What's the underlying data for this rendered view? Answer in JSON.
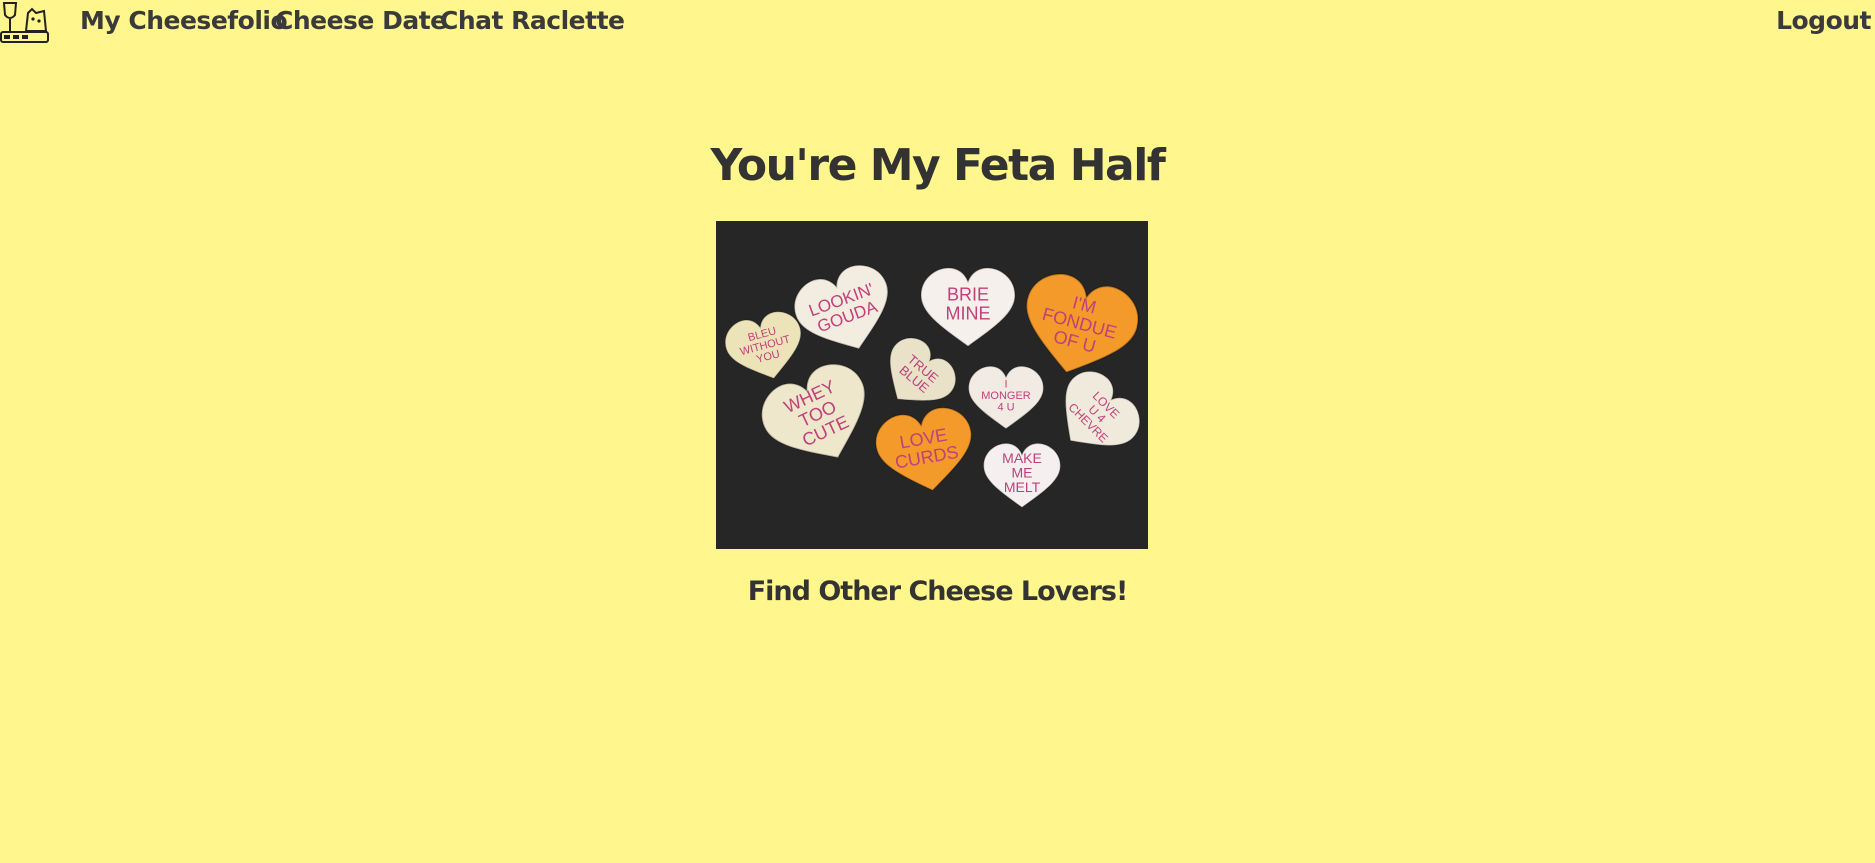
{
  "nav": {
    "logo_icon": "cheese-wine-logo-icon",
    "items": [
      {
        "label": "My Cheesefolio"
      },
      {
        "label": "Cheese Date"
      },
      {
        "label": "Chat Raclette"
      }
    ],
    "logout_label": "Logout"
  },
  "main": {
    "title": "You're My Feta Half",
    "cta_label": "Find Other Cheese Lovers!",
    "image": {
      "hearts": [
        {
          "text": [
            "BLEU",
            "WITHOUT",
            "YOU"
          ],
          "fill": "#ece4b8"
        },
        {
          "text": [
            "LOOKIN'",
            "GOUDA"
          ],
          "fill": "#f3ece0"
        },
        {
          "text": [
            "BRIE",
            "MINE"
          ],
          "fill": "#f6f0ec"
        },
        {
          "text": [
            "I'M",
            "FONDUE",
            "OF U"
          ],
          "fill": "#f39a2a"
        },
        {
          "text": [
            "TRUE",
            "BLUE"
          ],
          "fill": "#e9e1c8"
        },
        {
          "text": [
            "WHEY",
            "TOO",
            "CUTE"
          ],
          "fill": "#efe7cc"
        },
        {
          "text": [
            "I",
            "MONGER",
            "4 U"
          ],
          "fill": "#f1ebe4"
        },
        {
          "text": [
            "LOVE",
            "U 4",
            "CHEVRE"
          ],
          "fill": "#efeadc"
        },
        {
          "text": [
            "LOVE",
            "CURDS"
          ],
          "fill": "#f39a2a"
        },
        {
          "text": [
            "MAKE",
            "ME",
            "MELT"
          ],
          "fill": "#f5f0ef"
        }
      ]
    }
  },
  "colors": {
    "background": "#fff78d",
    "text": "#3a3a3a",
    "heart_text": "#c0407a"
  }
}
